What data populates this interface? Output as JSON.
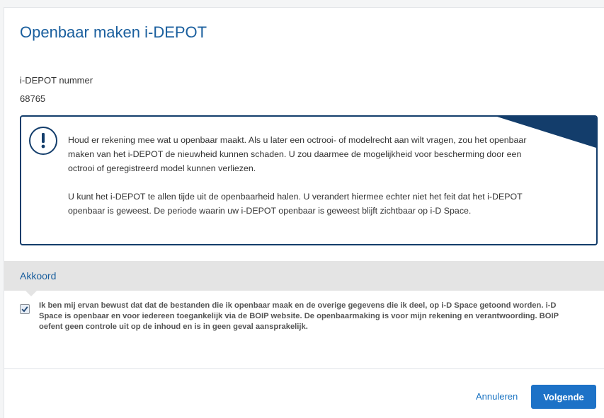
{
  "dialog": {
    "title": "Openbaar maken i-DEPOT"
  },
  "depot": {
    "label": "i-DEPOT nummer",
    "value": "68765"
  },
  "notice": {
    "icon": "exclamation-circle-icon",
    "paragraph_1": "Houd er rekening mee wat u openbaar maakt. Als u later een octrooi- of modelrecht aan wilt vragen, zou het openbaar maken van het i-DEPOT de nieuwheid kunnen schaden. U zou daarmee de mogelijkheid voor bescherming door een octrooi of geregistreerd model kunnen verliezen.",
    "paragraph_2": "U kunt het i-DEPOT te allen tijde uit de openbaarheid halen. U verandert hiermee echter niet het feit dat het i-DEPOT openbaar is geweest. De periode waarin uw i-DEPOT openbaar is geweest blijft zichtbaar op i-D Space."
  },
  "agreement": {
    "section_title": "Akkoord",
    "checked": true,
    "text": "Ik ben mij ervan bewust dat dat de bestanden die ik openbaar maak en de overige gegevens die ik deel, op i-D Space getoond worden. i-D Space is openbaar en voor iedereen toegankelijk via de BOIP website. De openbaarmaking is voor mijn rekening en verantwoording. BOIP oefent geen controle uit op de inhoud en is in geen geval aansprakelijk."
  },
  "footer": {
    "cancel_label": "Annuleren",
    "next_label": "Volgende"
  },
  "colors": {
    "title": "#1a5f9e",
    "notice_border": "#133d6b",
    "primary_button": "#1d72c7",
    "section_bar": "#e4e4e4"
  }
}
